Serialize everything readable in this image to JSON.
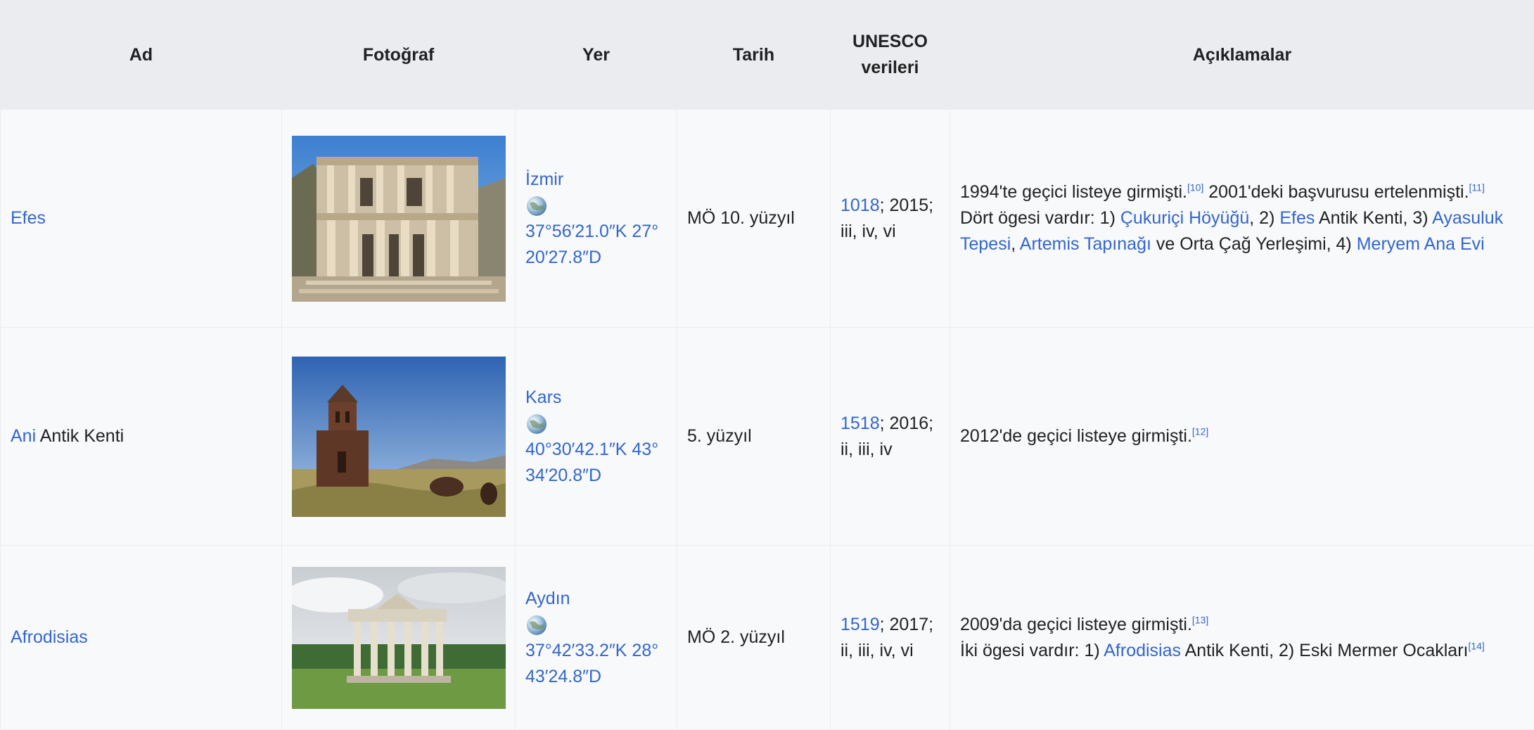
{
  "table": {
    "headers": {
      "ad": "Ad",
      "fotograf": "Fotoğraf",
      "yer": "Yer",
      "tarih": "Tarih",
      "unesco_line1": "UNESCO",
      "unesco_line2": "verileri",
      "aciklamalar": "Açıklamalar"
    },
    "rows": [
      {
        "name_link": "Efes",
        "name_rest": "",
        "photo_icon": "library-of-celsus-photo",
        "location": "İzmir",
        "coord_line1": "37°56′21.0″K 27°",
        "coord_line2": "20′27.8″D",
        "date": "MÖ 10. yüzyıl",
        "unesco_id": "1018",
        "unesco_year": "; 2015;",
        "unesco_criteria": "iii, iv, vi",
        "desc_a": "1994'te geçici listeye girmişti.",
        "desc_ref1": "[10]",
        "desc_b": " 2001'deki başvurusu ertelenmişti.",
        "desc_ref2": "[11]",
        "desc_c": "Dört ögesi vardır: 1) ",
        "desc_link1": "Çukuriçi Höyüğü",
        "desc_d": ", 2) ",
        "desc_link2": "Efes",
        "desc_e": " Antik Kenti, 3) ",
        "desc_link3": "Ayasuluk Tepesi",
        "desc_f": ", ",
        "desc_link4": "Artemis Tapınağı",
        "desc_g": " ve Orta Çağ Yerleşimi, 4) ",
        "desc_link5": "Meryem Ana Evi"
      },
      {
        "name_link": "Ani",
        "name_rest": " Antik Kenti",
        "photo_icon": "ani-cathedral-photo",
        "location": "Kars",
        "coord_line1": "40°30′42.1″K 43°",
        "coord_line2": "34′20.8″D",
        "date": "5. yüzyıl",
        "unesco_id": "1518",
        "unesco_year": "; 2016;",
        "unesco_criteria": "ii, iii, iv",
        "desc_a": "2012'de geçici listeye girmişti.",
        "desc_ref1": "[12]"
      },
      {
        "name_link": "Afrodisias",
        "name_rest": "",
        "photo_icon": "tetrapylon-photo",
        "location": "Aydın",
        "coord_line1": "37°42′33.2″K 28°",
        "coord_line2": "43′24.8″D",
        "date": "MÖ 2. yüzyıl",
        "unesco_id": "1519",
        "unesco_year": "; 2017;",
        "unesco_criteria": "ii, iii, iv, vi",
        "desc_a": "2009'da geçici listeye girmişti.",
        "desc_ref1": "[13]",
        "desc_c": "İki ögesi vardır: 1) ",
        "desc_link1": "Afrodisias",
        "desc_d": " Antik Kenti, 2) Eski Mermer Ocakları",
        "desc_ref2": "[14]"
      }
    ]
  },
  "colors": {
    "link": "#3366cc",
    "header_bg": "#eaecf0",
    "cell_bg": "#f8f9fa",
    "text": "#202122"
  }
}
